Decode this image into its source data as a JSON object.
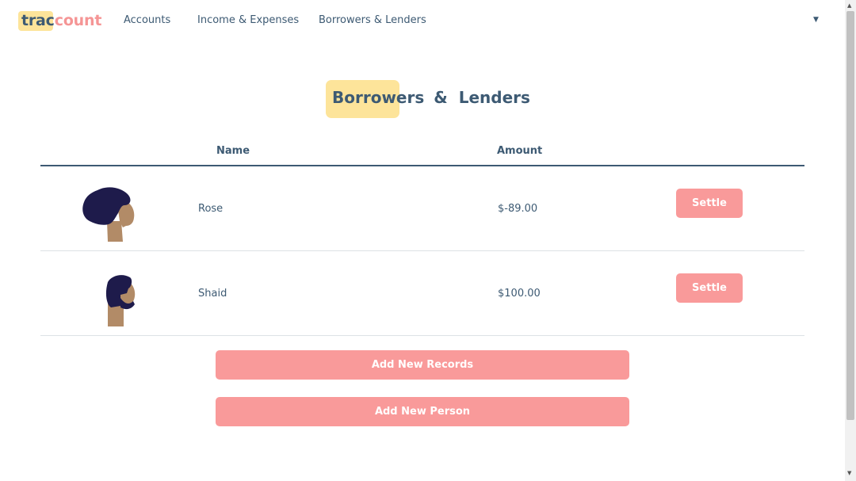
{
  "app": {
    "logo_part1": "trac",
    "logo_part2": "count",
    "brand_color": "#f59595",
    "highlight_color": "#fde49a",
    "text_color": "#3d5a73"
  },
  "nav": {
    "links": [
      {
        "label": "Accounts"
      },
      {
        "label": "Income & Expenses"
      },
      {
        "label": "Borrowers & Lenders"
      }
    ],
    "dropdown_icon": "caret-down-icon"
  },
  "page": {
    "title_word1": "Borrowers",
    "title_amp": "&",
    "title_word2": "Lenders"
  },
  "table": {
    "headers": {
      "name": "Name",
      "amount": "Amount"
    },
    "rows": [
      {
        "name": "Rose",
        "amount": "$-89.00",
        "action": "Settle",
        "avatar": "woman-avatar-icon"
      },
      {
        "name": "Shaid",
        "amount": "$100.00",
        "action": "Settle",
        "avatar": "man-avatar-icon"
      }
    ]
  },
  "actions": {
    "add_records": "Add New Records",
    "add_person": "Add New Person"
  }
}
